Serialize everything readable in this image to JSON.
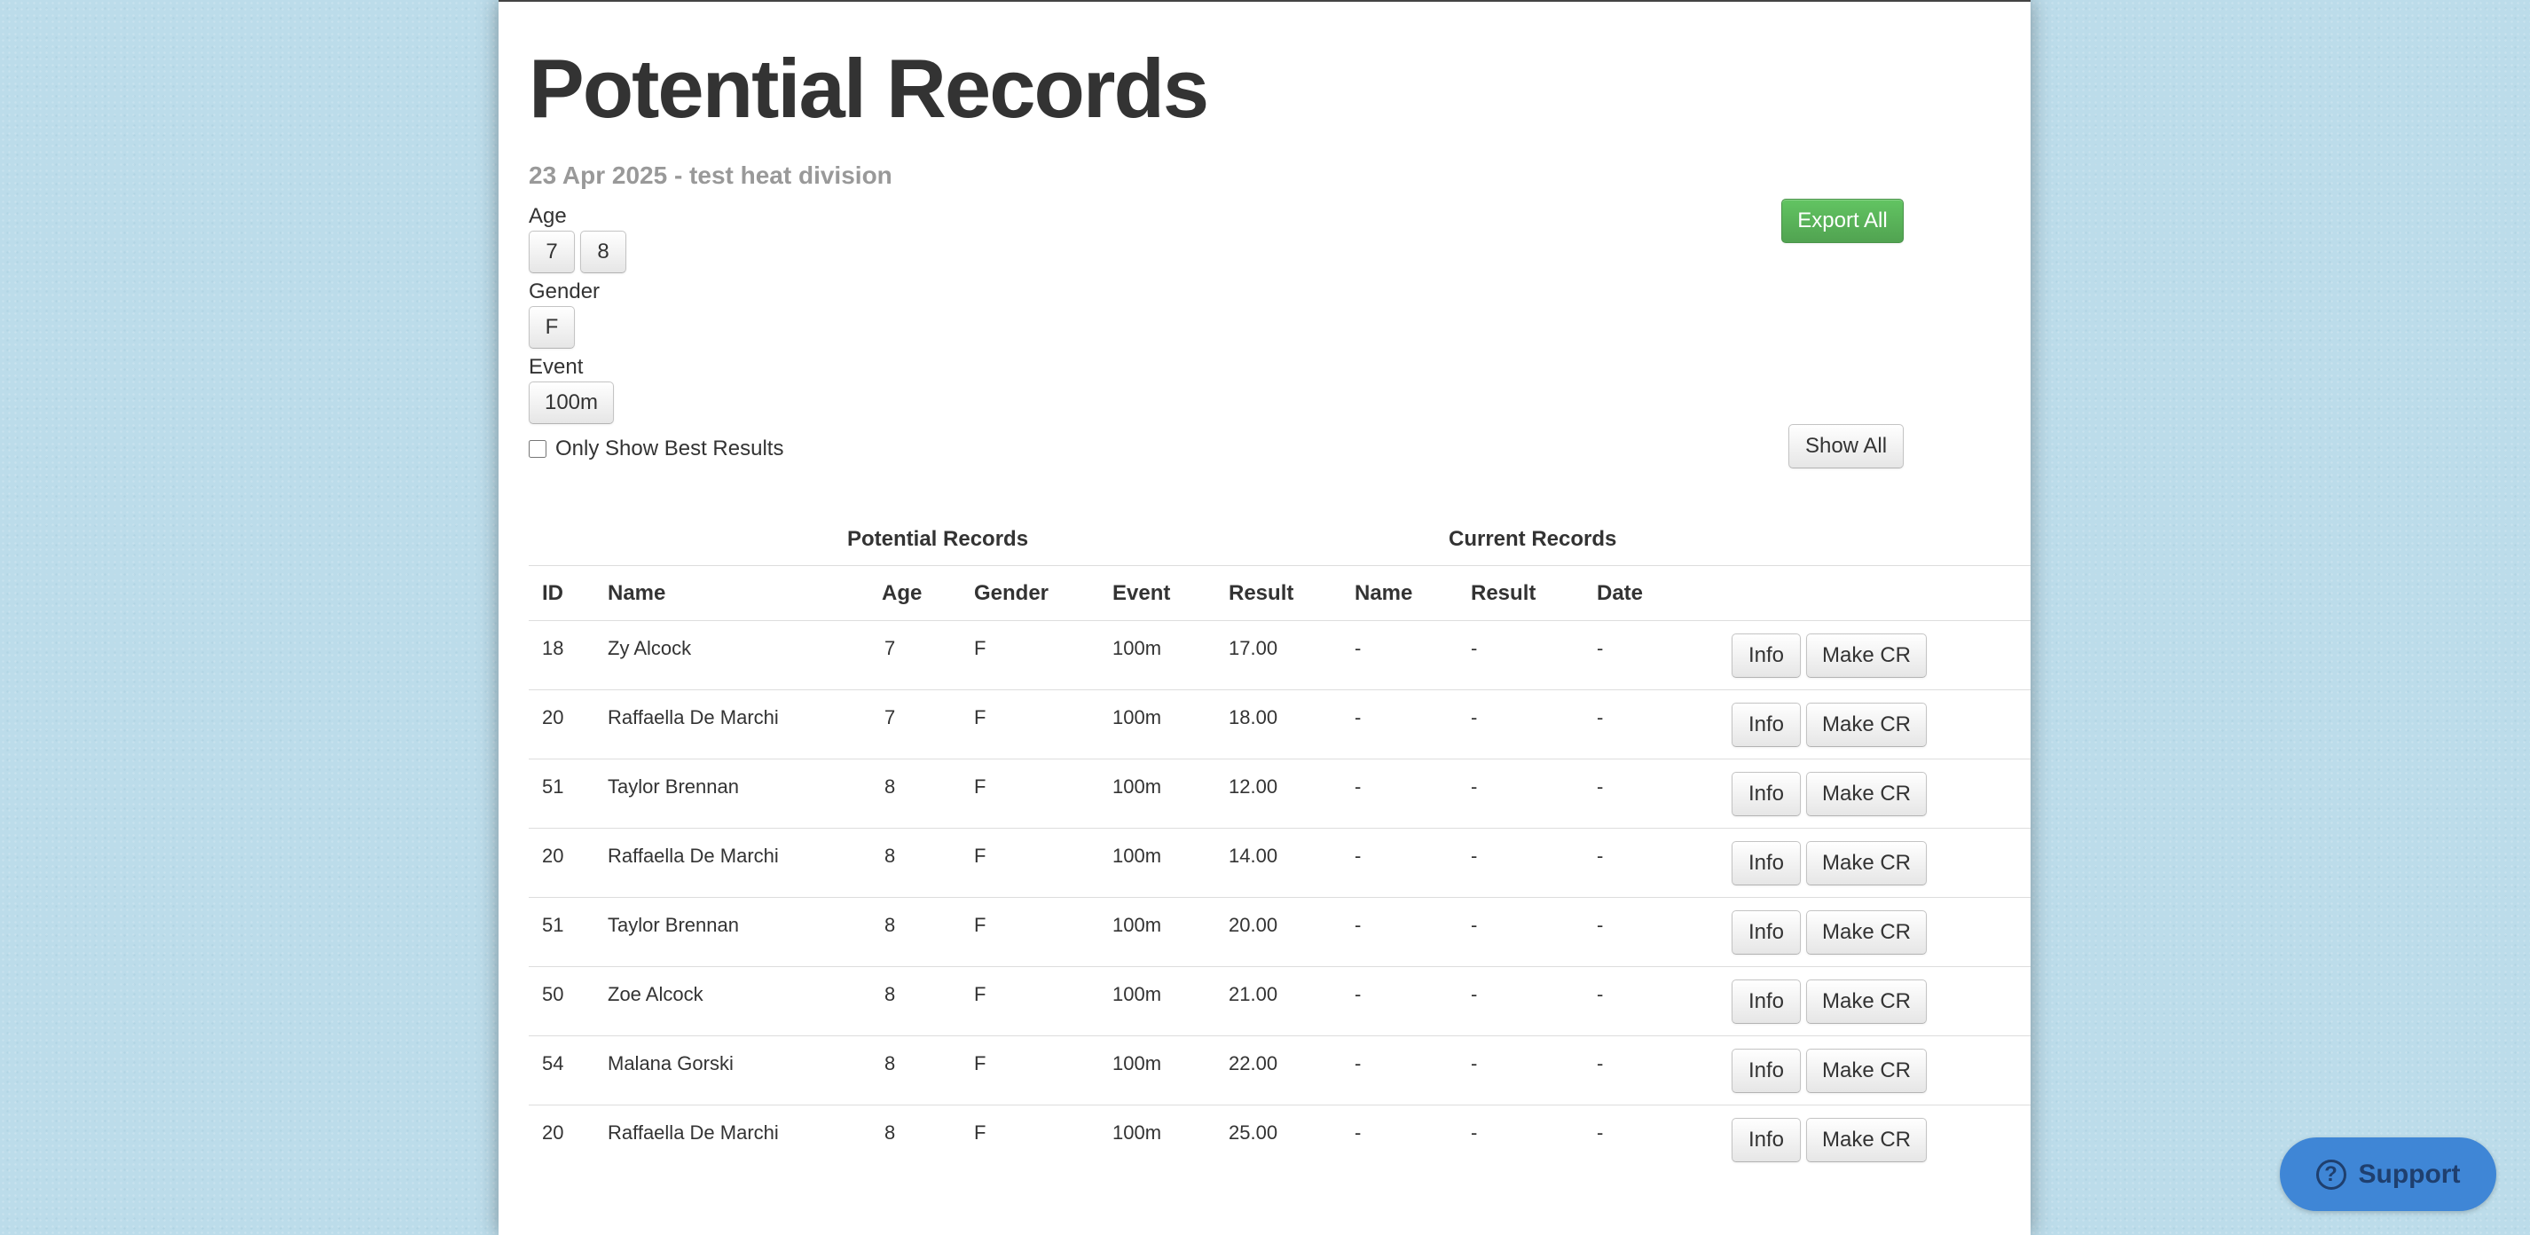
{
  "page": {
    "title": "Potential Records",
    "subtitle": "23 Apr 2025 - test heat division"
  },
  "filters": {
    "age_label": "Age",
    "age_options": [
      "7",
      "8"
    ],
    "gender_label": "Gender",
    "gender_options": [
      "F"
    ],
    "event_label": "Event",
    "event_options": [
      "100m"
    ],
    "best_results_label": "Only Show Best Results",
    "best_results_checked": false
  },
  "actions": {
    "export_all": "Export All",
    "show_all": "Show All"
  },
  "table": {
    "group_potential": "Potential Records",
    "group_current": "Current Records",
    "columns": [
      "ID",
      "Name",
      "Age",
      "Gender",
      "Event",
      "Result",
      "Name",
      "Result",
      "Date"
    ],
    "info_label": "Info",
    "make_cr_label": "Make CR",
    "rows": [
      {
        "id": "18",
        "name": "Zy Alcock",
        "age": "7",
        "gender": "F",
        "event": "100m",
        "result": "17.00",
        "cr_name": "-",
        "cr_result": "-",
        "cr_date": "-"
      },
      {
        "id": "20",
        "name": "Raffaella De Marchi",
        "age": "7",
        "gender": "F",
        "event": "100m",
        "result": "18.00",
        "cr_name": "-",
        "cr_result": "-",
        "cr_date": "-"
      },
      {
        "id": "51",
        "name": "Taylor Brennan",
        "age": "8",
        "gender": "F",
        "event": "100m",
        "result": "12.00",
        "cr_name": "-",
        "cr_result": "-",
        "cr_date": "-"
      },
      {
        "id": "20",
        "name": "Raffaella De Marchi",
        "age": "8",
        "gender": "F",
        "event": "100m",
        "result": "14.00",
        "cr_name": "-",
        "cr_result": "-",
        "cr_date": "-"
      },
      {
        "id": "51",
        "name": "Taylor Brennan",
        "age": "8",
        "gender": "F",
        "event": "100m",
        "result": "20.00",
        "cr_name": "-",
        "cr_result": "-",
        "cr_date": "-"
      },
      {
        "id": "50",
        "name": "Zoe Alcock",
        "age": "8",
        "gender": "F",
        "event": "100m",
        "result": "21.00",
        "cr_name": "-",
        "cr_result": "-",
        "cr_date": "-"
      },
      {
        "id": "54",
        "name": "Malana Gorski",
        "age": "8",
        "gender": "F",
        "event": "100m",
        "result": "22.00",
        "cr_name": "-",
        "cr_result": "-",
        "cr_date": "-"
      },
      {
        "id": "20",
        "name": "Raffaella De Marchi",
        "age": "8",
        "gender": "F",
        "event": "100m",
        "result": "25.00",
        "cr_name": "-",
        "cr_result": "-",
        "cr_date": "-"
      }
    ]
  },
  "support": {
    "label": "Support",
    "icon": "question-circle-icon"
  }
}
